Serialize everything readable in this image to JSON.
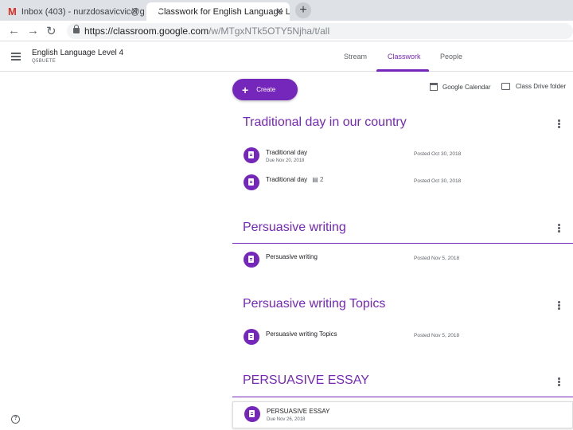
{
  "browser": {
    "tabs": [
      {
        "title": "Inbox (403) - nurzdosavicvic@gcc",
        "close": "✕"
      },
      {
        "title": "Classwork for English Language L",
        "close": "✕"
      }
    ],
    "new_tab": "+",
    "url_host": "https://classroom.google.com",
    "url_path": "/w/MTgxNTk5OTY5Njha/t/all"
  },
  "header": {
    "class_title": "English Language Level 4",
    "class_code": "Q5BUETE",
    "tabs": [
      {
        "label": "Stream"
      },
      {
        "label": "Classwork"
      },
      {
        "label": "People"
      }
    ],
    "active_tab": "Classwork"
  },
  "toolbar": {
    "create_label": "Create",
    "calendar_label": "Google Calendar",
    "drive_label": "Class Drive folder"
  },
  "topics": [
    {
      "title": "Traditional day in our country",
      "items": [
        {
          "title": "Traditional day",
          "due": "Due Nov 20, 2018",
          "posted": "Posted Oct 30, 2018"
        },
        {
          "title": "Traditional day",
          "comments": "2",
          "posted": "Posted Oct 30, 2018"
        }
      ]
    },
    {
      "title": "Persuasive writing",
      "items": [
        {
          "title": "Persuasive writing",
          "posted": "Posted Nov 5, 2018"
        }
      ]
    },
    {
      "title": "Persuasive writing Topics",
      "items": [
        {
          "title": "Persuasive writing Topics",
          "posted": "Posted Nov 5, 2018"
        }
      ]
    },
    {
      "title": "PERSUASIVE ESSAY",
      "items": [
        {
          "title": "PERSUASIVE ESSAY",
          "due": "Due Nov 26, 2018"
        }
      ]
    }
  ],
  "help_label": "?",
  "colors": {
    "accent": "#7627bb",
    "text": "#202124",
    "muted": "#5f6368"
  }
}
